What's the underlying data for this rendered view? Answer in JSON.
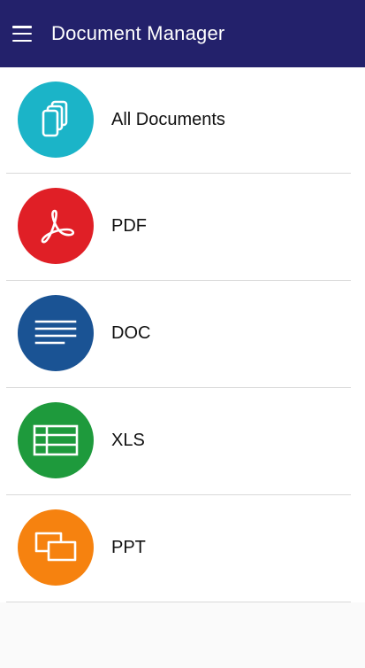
{
  "app_bar": {
    "title": "Document Manager",
    "menu_icon": "hamburger-menu-icon",
    "background": "#23216b"
  },
  "categories": [
    {
      "label": "All Documents",
      "icon": "documents-stack-icon",
      "color": "#1bb4c8"
    },
    {
      "label": "PDF",
      "icon": "pdf-icon",
      "color": "#e01f26"
    },
    {
      "label": "DOC",
      "icon": "text-lines-icon",
      "color": "#1a5394"
    },
    {
      "label": "XLS",
      "icon": "spreadsheet-icon",
      "color": "#1e9a3c"
    },
    {
      "label": "PPT",
      "icon": "presentation-slides-icon",
      "color": "#f6820f"
    }
  ]
}
